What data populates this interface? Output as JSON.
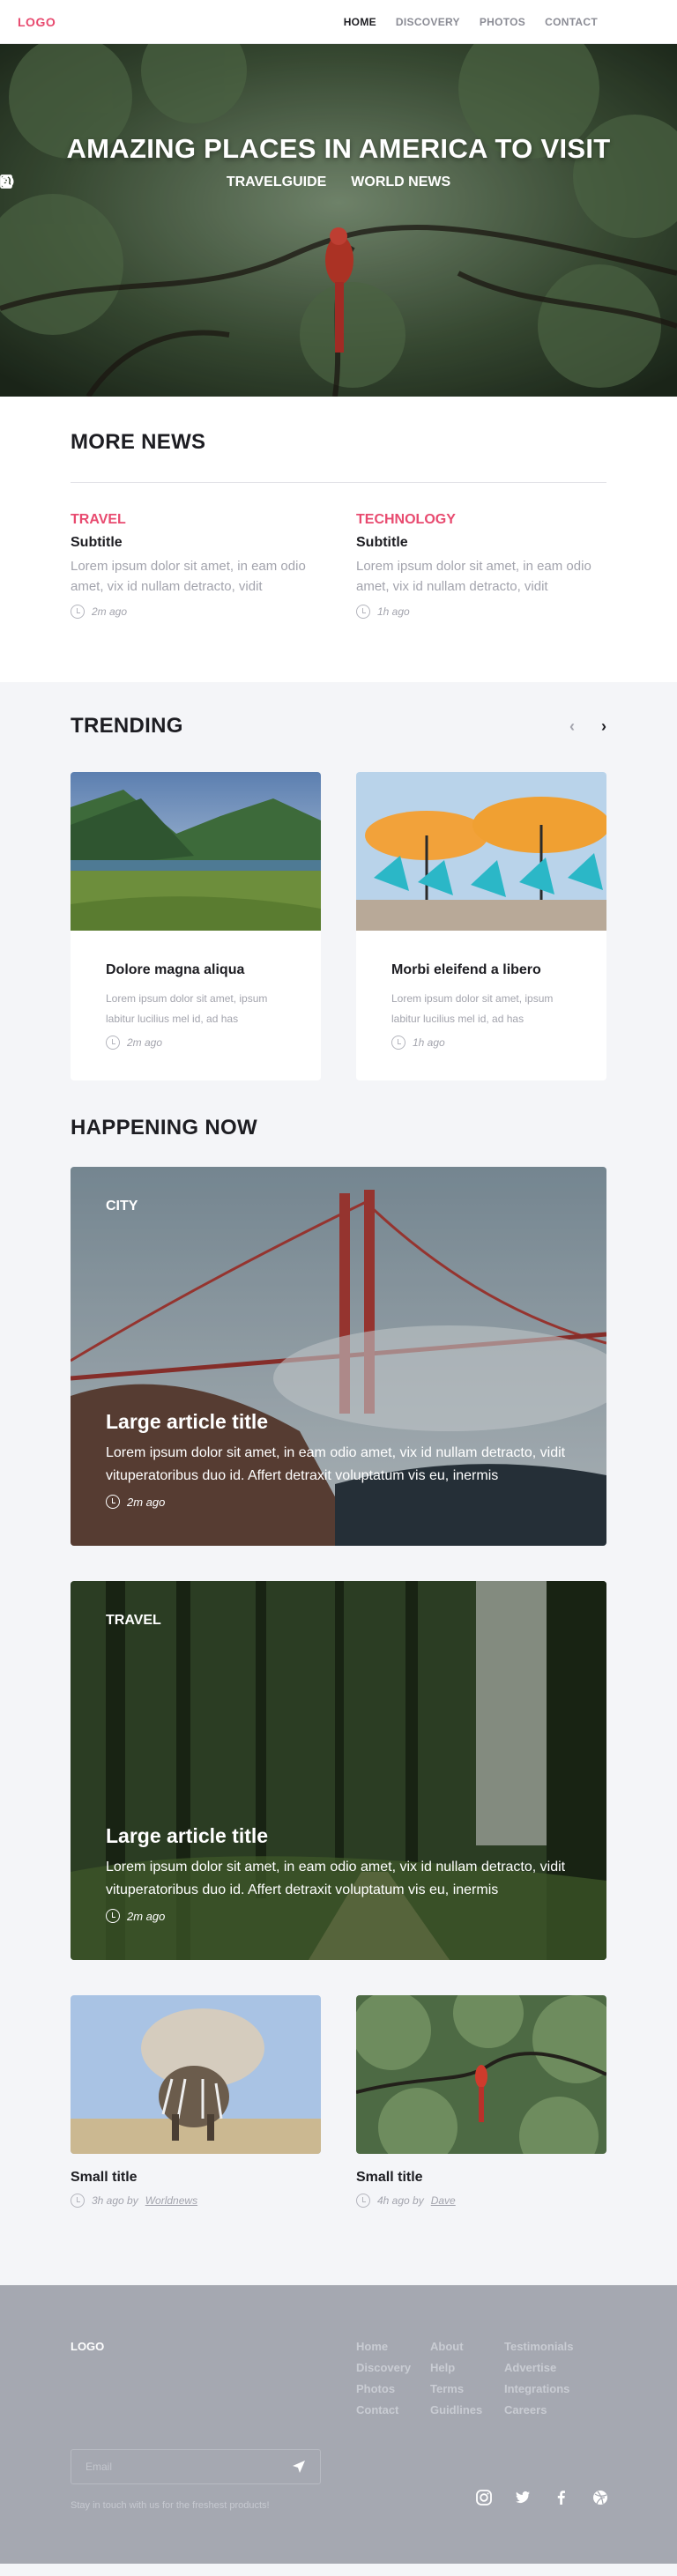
{
  "nav": {
    "logo": "LOGO",
    "items": [
      {
        "label": "HOME",
        "active": true
      },
      {
        "label": "DISCOVERY",
        "active": false
      },
      {
        "label": "PHOTOS",
        "active": false
      },
      {
        "label": "CONTACT",
        "active": false
      }
    ]
  },
  "hero": {
    "title": "AMAZING PLACES IN AMERICA TO VISIT",
    "tags": [
      "TRAVELGUIDE",
      "WORLD NEWS"
    ]
  },
  "more_news": {
    "heading": "MORE NEWS",
    "items": [
      {
        "category": "TRAVEL",
        "subtitle": "Subtitle",
        "text": "Lorem ipsum dolor sit amet, in eam odio amet, vix id nullam detracto, vidit",
        "time": "2m ago"
      },
      {
        "category": "TECHNOLOGY",
        "subtitle": "Subtitle",
        "text": "Lorem ipsum dolor sit amet, in eam odio amet, vix id nullam detracto, vidit",
        "time": "1h ago"
      }
    ]
  },
  "trending": {
    "heading": "TRENDING",
    "prev": "‹",
    "next": "›",
    "cards": [
      {
        "title": "Dolore magna aliqua",
        "text": "Lorem ipsum dolor sit amet, ipsum labitur lucilius mel id, ad has",
        "time": "2m ago"
      },
      {
        "title": "Morbi eleifend a libero",
        "text": "Lorem ipsum dolor sit amet, ipsum labitur lucilius mel id, ad has",
        "time": "1h ago"
      }
    ]
  },
  "happening": {
    "heading": "HAPPENING NOW",
    "articles": [
      {
        "tag": "CITY",
        "title": "Large article title",
        "text": "Lorem ipsum dolor sit amet, in eam odio amet, vix id nullam detracto, vidit vituperatoribus duo id. Affert detraxit voluptatum vis eu, inermis",
        "time": "2m ago"
      },
      {
        "tag": "TRAVEL",
        "title": "Large article title",
        "text": "Lorem ipsum dolor sit amet, in eam odio amet, vix id nullam detracto, vidit vituperatoribus duo id. Affert detraxit voluptatum vis eu, inermis",
        "time": "2m ago"
      }
    ],
    "small": [
      {
        "title": "Small title",
        "meta": "3h ago by",
        "author": "Worldnews"
      },
      {
        "title": "Small title",
        "meta": "4h ago by",
        "author": "Dave"
      }
    ]
  },
  "footer": {
    "logo": "LOGO",
    "columns": [
      [
        "Home",
        "Discovery",
        "Photos",
        "Contact"
      ],
      [
        "About",
        "Help",
        "Terms",
        "Guidlines"
      ],
      [
        "Testimonials",
        "Advertise",
        "Integrations",
        "Careers"
      ]
    ],
    "email_placeholder": "Email",
    "stay_text": "Stay in touch with us for the freshest products!",
    "social": [
      "instagram-icon",
      "twitter-icon",
      "facebook-icon",
      "dribbble-icon"
    ]
  },
  "colors": {
    "accent": "#e84a6f",
    "footer_bg": "#a5a8b1",
    "page_bg": "#f4f5f8"
  }
}
